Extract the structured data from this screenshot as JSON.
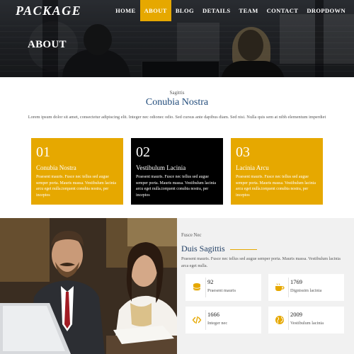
{
  "brand": {
    "logo": "PACKAGE",
    "accent": "#e6a800",
    "dark_title": "#1f4a7a"
  },
  "nav": {
    "items": [
      {
        "label": "HOME"
      },
      {
        "label": "ABOUT",
        "active": true
      },
      {
        "label": "BLOG"
      },
      {
        "label": "DETAILS"
      },
      {
        "label": "TEAM"
      },
      {
        "label": "CONTACT"
      },
      {
        "label": "DROPDOWN"
      }
    ]
  },
  "hero": {
    "title": "ABOUT"
  },
  "intro": {
    "eyebrow": "Sagittis",
    "title": "Conubia Nostra",
    "text": "Lorem ipsum dolor sit amet, consectetur adipiscing elit. Integer nec odionec odio. Sed cursus ante dapibus diam. Sed nisi. Nulla quis sem at nibh elementum imperdiet"
  },
  "cards": [
    {
      "number": "01",
      "title": "Conubia Nostra",
      "text": "Praesent mauris. Fusce nec tellus sed augue semper porta. Mauris massa. Vestibulum lacinia arcu eget nulla.torquent conubia nostra, per inceptos",
      "color": "#e6a800"
    },
    {
      "number": "02",
      "title": "Vestibulum Lacinia",
      "text": "Praesent mauris. Fusce nec tellus sed augue semper porta. Mauris massa. Vestibulum lacinia arcu eget nulla.torquent conubia nostra, per inceptos",
      "color": "#000000"
    },
    {
      "number": "03",
      "title": "Lacinia Arcu",
      "text": "Praesent mauris. Fusce nec tellus sed augue semper porta. Mauris massa. Vestibulum lacinia arcu eget nulla.torquent conubia nostra, per inceptos",
      "color": "#e6a800"
    }
  ],
  "feature": {
    "eyebrow": "Fusce Nec",
    "title": "Duis Sagittis",
    "text": "Praesent mauris. Fusce nec tellus sed augue semper porta. Mauris massa. Vestibulum lacinia arca eget nulla.",
    "stats": [
      {
        "icon": "database-icon",
        "value": "92",
        "label": "Praesent mauris"
      },
      {
        "icon": "coffee-icon",
        "value": "1769",
        "label": "Dignissim lacinia"
      },
      {
        "icon": "code-icon",
        "value": "1666",
        "label": "Integer nec"
      },
      {
        "icon": "globe-icon",
        "value": "2009",
        "label": "Vestibulum lacinia"
      }
    ]
  }
}
